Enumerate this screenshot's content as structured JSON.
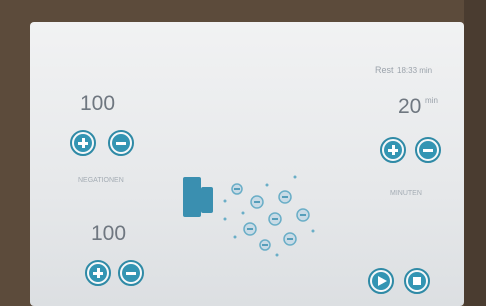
{
  "top_right": {
    "rest_label": "Rest",
    "rest_time": "18:33 min"
  },
  "left_panel": {
    "value1": "100",
    "value1_label": "NEGATIONEN",
    "value2": "100"
  },
  "right_panel": {
    "duration_value": "20",
    "duration_unit": "min",
    "duration_label": "MINUTEN"
  },
  "colors": {
    "accent": "#3395b3",
    "text": "#6f7780"
  },
  "icons": [
    "plus-icon",
    "minus-icon",
    "play-icon",
    "stop-icon",
    "ion-emitter-icon"
  ]
}
